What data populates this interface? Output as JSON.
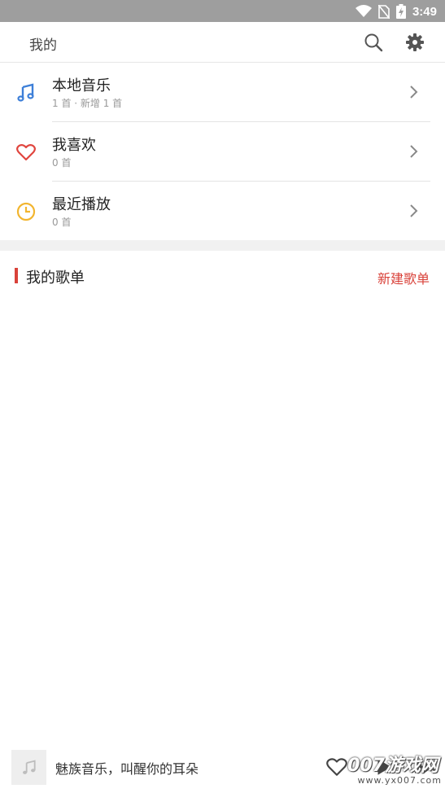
{
  "status_bar": {
    "time": "3:49",
    "icons": [
      "wifi-icon",
      "no-sim-icon",
      "battery-charging-icon"
    ]
  },
  "app_bar": {
    "title": "我的",
    "actions": [
      "search-icon",
      "settings-gear-icon"
    ]
  },
  "menu": [
    {
      "title": "本地音乐",
      "subtitle": "1 首 · 新增 1 首",
      "icon": "music-note-icon",
      "icon_color": "#3d7fd8"
    },
    {
      "title": "我喜欢",
      "subtitle": "0 首",
      "icon": "heart-icon",
      "icon_color": "#e0453e"
    },
    {
      "title": "最近播放",
      "subtitle": "0 首",
      "icon": "clock-icon",
      "icon_color": "#f2b52f"
    }
  ],
  "playlists": {
    "title": "我的歌单",
    "action": "新建歌单"
  },
  "player": {
    "text": "魅族音乐，叫醒你的耳朵",
    "controls": [
      "heart-outline-icon",
      "play-icon",
      "next-icon"
    ]
  },
  "watermark": {
    "main": "007游戏网",
    "url": "www.yx007.com"
  },
  "colors": {
    "accent": "#d9423a",
    "status_bar": "#9e9e9e",
    "section_band": "#f1f1f1"
  }
}
